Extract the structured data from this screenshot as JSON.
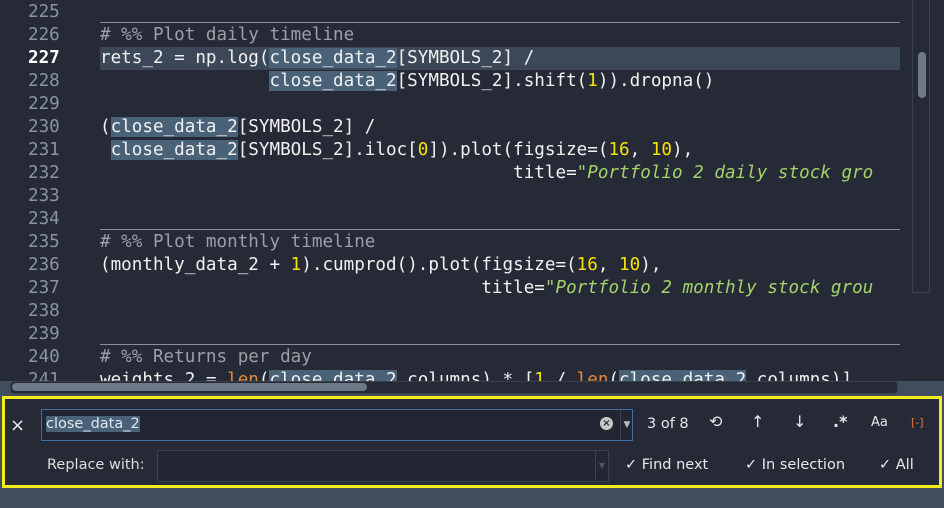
{
  "editor": {
    "current_line": "227",
    "lines": [
      {
        "num": "225",
        "segs": []
      },
      {
        "num": "226",
        "sep": true,
        "segs": [
          [
            "# %% Plot daily timeline",
            "c"
          ]
        ]
      },
      {
        "num": "227",
        "segs": [
          [
            "rets_2 = np.log(",
            ""
          ],
          [
            "close_data_2",
            "h"
          ],
          [
            "[SYMBOLS_2] /",
            ""
          ]
        ]
      },
      {
        "num": "228",
        "segs": [
          [
            "                ",
            ""
          ],
          [
            "close_data_2",
            "h"
          ],
          [
            "[SYMBOLS_2].shift(",
            ""
          ],
          [
            "1",
            "n"
          ],
          [
            ")).dropna()",
            ""
          ]
        ]
      },
      {
        "num": "229",
        "segs": []
      },
      {
        "num": "230",
        "segs": [
          [
            "(",
            ""
          ],
          [
            "close_data_2",
            "h"
          ],
          [
            "[SYMBOLS_2] /",
            ""
          ]
        ]
      },
      {
        "num": "231",
        "segs": [
          [
            " ",
            ""
          ],
          [
            "close_data_2",
            "h"
          ],
          [
            "[SYMBOLS_2].iloc[",
            ""
          ],
          [
            "0",
            "n"
          ],
          [
            "]).plot(figsize=(",
            ""
          ],
          [
            "16",
            "n"
          ],
          [
            ", ",
            ""
          ],
          [
            "10",
            "n"
          ],
          [
            "),",
            ""
          ]
        ]
      },
      {
        "num": "232",
        "segs": [
          [
            "                                       title=",
            ""
          ],
          [
            "\"Portfolio 2 daily stock gro",
            "s"
          ]
        ]
      },
      {
        "num": "233",
        "segs": []
      },
      {
        "num": "234",
        "segs": []
      },
      {
        "num": "235",
        "sep": true,
        "segs": [
          [
            "# %% Plot monthly timeline",
            "c"
          ]
        ]
      },
      {
        "num": "236",
        "segs": [
          [
            "(monthly_data_2 + ",
            ""
          ],
          [
            "1",
            "n"
          ],
          [
            ").cumprod().plot(figsize=(",
            ""
          ],
          [
            "16",
            "n"
          ],
          [
            ", ",
            ""
          ],
          [
            "10",
            "n"
          ],
          [
            "),",
            ""
          ]
        ]
      },
      {
        "num": "237",
        "segs": [
          [
            "                                    title=",
            ""
          ],
          [
            "\"Portfolio 2 monthly stock grou",
            "s"
          ]
        ]
      },
      {
        "num": "238",
        "segs": []
      },
      {
        "num": "239",
        "segs": []
      },
      {
        "num": "240",
        "sep": true,
        "segs": [
          [
            "# %% Returns per day",
            "c"
          ]
        ]
      },
      {
        "num": "241",
        "segs": [
          [
            "weights_2 = ",
            ""
          ],
          [
            "len",
            "b"
          ],
          [
            "(",
            ""
          ],
          [
            "close_data_2",
            "h"
          ],
          [
            ".columns) * [",
            ""
          ],
          [
            "1",
            "n"
          ],
          [
            " / ",
            ""
          ],
          [
            "len",
            "b"
          ],
          [
            "(",
            ""
          ],
          [
            "close_data_2",
            "h"
          ],
          [
            ".columns)]",
            ""
          ]
        ]
      }
    ]
  },
  "find": {
    "close_icon": "×",
    "search_value": "close_data_2",
    "match_count": "3 of 8",
    "replace_label": "Replace with:",
    "replace_value": "",
    "find_next": "Find next",
    "in_selection": "In selection",
    "all": "All",
    "check": "✓",
    "icons": {
      "wrap": "⟲",
      "prev": "↑",
      "next": "↓",
      "regex": ".*",
      "case": "Aa",
      "word": "[-]"
    }
  },
  "colors": {
    "highlight_border": "#f4ec1c",
    "match_bg": "#4a6278"
  }
}
